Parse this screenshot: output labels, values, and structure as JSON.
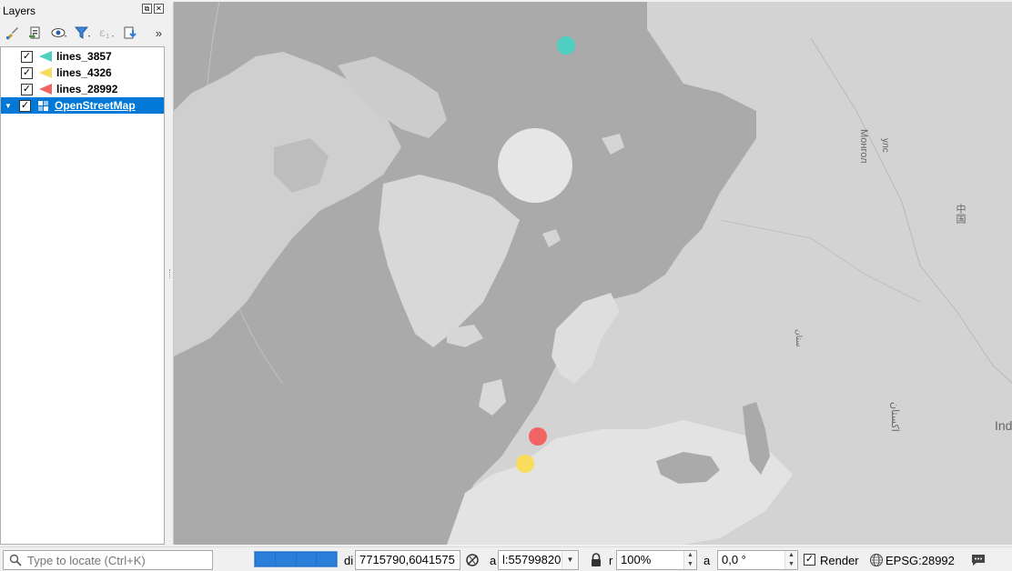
{
  "panel": {
    "title": "Layers",
    "float_btn": "⧉",
    "close_btn": "✕",
    "more": "»"
  },
  "layers": [
    {
      "name": "lines_3857",
      "color": "#4fcfc0",
      "checked": true,
      "selected": false
    },
    {
      "name": "lines_4326",
      "color": "#f9dc5c",
      "checked": true,
      "selected": false
    },
    {
      "name": "lines_28992",
      "color": "#f26464",
      "checked": true,
      "selected": false
    },
    {
      "name": "OpenStreetMap",
      "color": "",
      "checked": true,
      "selected": true
    }
  ],
  "map": {
    "labels": [
      "Монгол",
      "улс",
      "中国",
      "ستان",
      "اکستان",
      "Ind"
    ]
  },
  "status": {
    "locator_placeholder": "Type to locate (Ctrl+K)",
    "coord_label": "di",
    "coordinate": "7715790,6041575",
    "scale_label": "a",
    "scale": "l:55799820",
    "magnifier_label": "r",
    "magnifier": "100%",
    "rotation_label": "a",
    "rotation": "0,0 °",
    "render_label": "Render",
    "render_checked": true,
    "crs": "EPSG:28992"
  },
  "colors": {
    "accent": "#0078d7",
    "map_water": "#aaaaaa",
    "map_land": "#d4d4d4",
    "dot_teal": "#4fcfc0",
    "dot_yellow": "#f9dc5c",
    "dot_red": "#f26464"
  }
}
